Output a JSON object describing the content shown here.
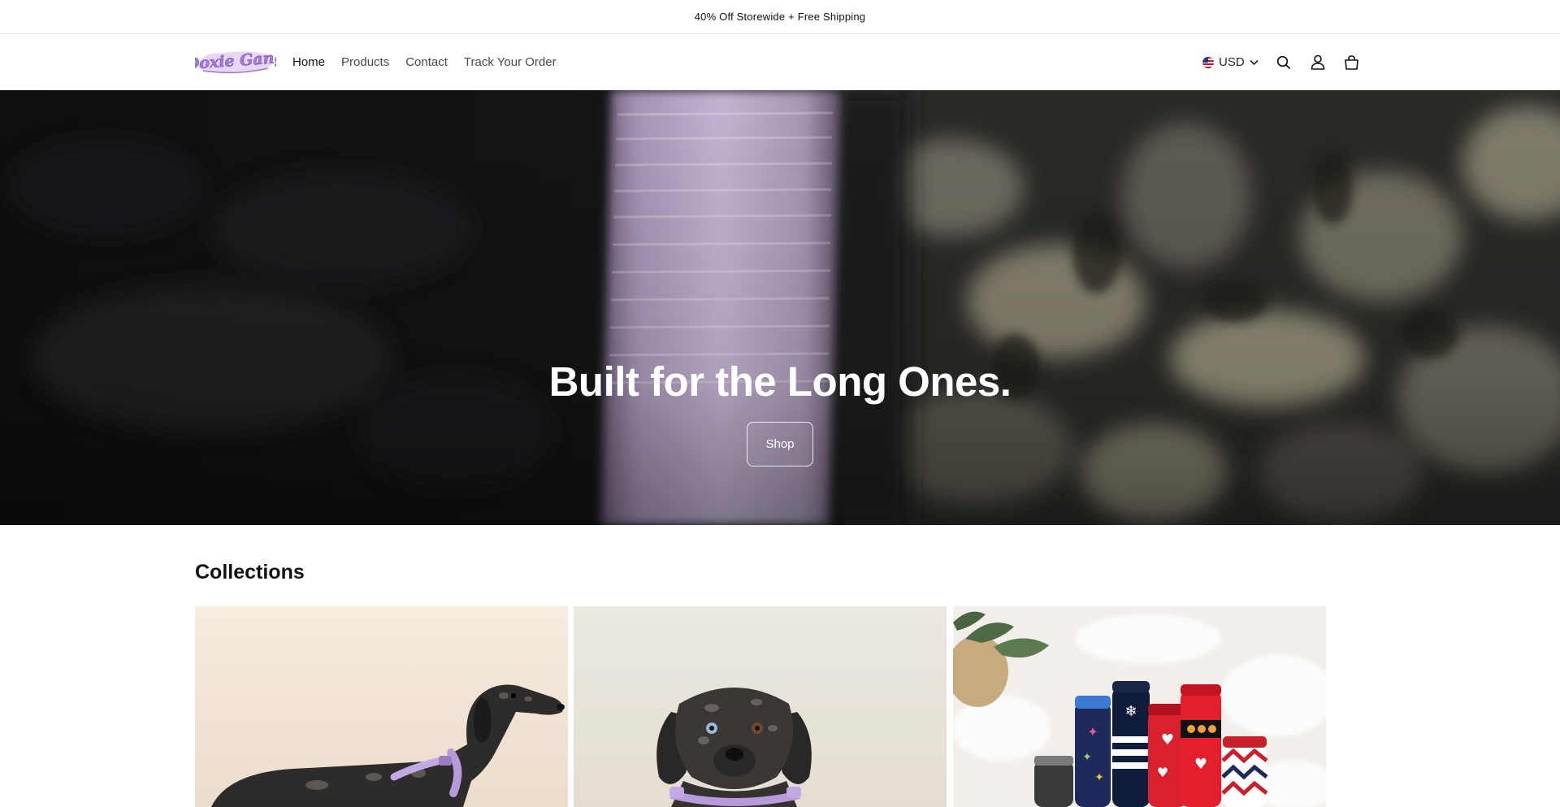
{
  "announcement": {
    "text": "40% Off Storewide + Free Shipping"
  },
  "header": {
    "logo_text": "Doxie Gang",
    "nav": [
      {
        "label": "Home",
        "active": true
      },
      {
        "label": "Products"
      },
      {
        "label": "Contact"
      },
      {
        "label": "Track Your Order"
      }
    ],
    "currency": {
      "label": "USD",
      "flag_icon": "us-flag-icon"
    },
    "icons": [
      "search-icon",
      "account-icon",
      "cart-icon"
    ]
  },
  "hero": {
    "title": "Built for the Long Ones.",
    "button_label": "Shop"
  },
  "collections": {
    "title": "Collections",
    "cards": [
      {
        "image": "dachshund-profile-lilac-harness"
      },
      {
        "image": "dachshund-front-lilac-harness"
      },
      {
        "image": "dog-sweaters-pile"
      }
    ]
  },
  "colors": {
    "accent_lilac": "#b79ad9",
    "hero_dark": "#141414",
    "text": "#121212"
  }
}
